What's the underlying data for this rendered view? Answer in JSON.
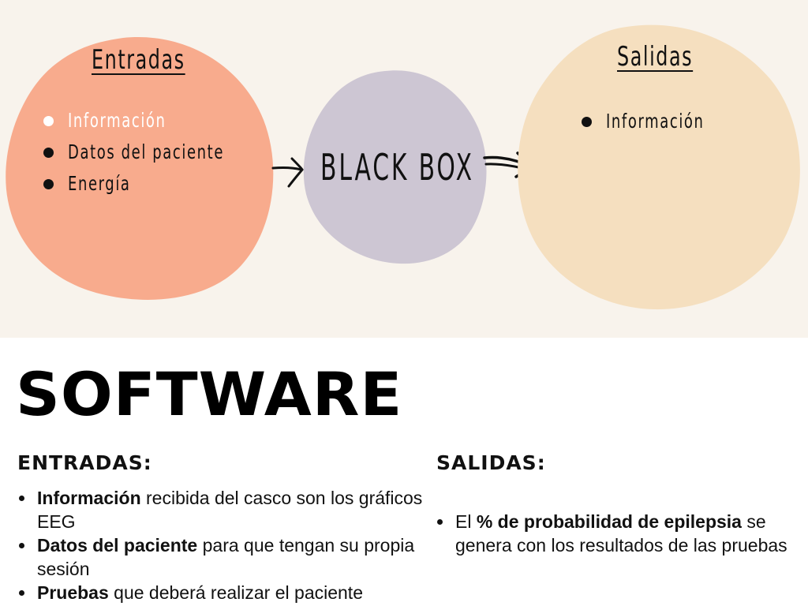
{
  "diagram": {
    "inputs": {
      "title": "Entradas",
      "color": "#f8ab8d",
      "items": [
        {
          "label": "Información",
          "highlighted": true
        },
        {
          "label": "Datos del paciente",
          "highlighted": false
        },
        {
          "label": "Energía",
          "highlighted": false
        }
      ]
    },
    "box": {
      "label": "BLACK BOX",
      "color": "#cdc6d3"
    },
    "outputs": {
      "title": "Salidas",
      "color": "#f5dfbf",
      "items": [
        {
          "label": "Información"
        }
      ]
    },
    "background_color": "#f8f3ec"
  },
  "software": {
    "title": "SOFTWARE",
    "inputs": {
      "heading": "ENTRADAS:",
      "items": [
        {
          "bold": "Información",
          "rest": " recibida del casco son los gráficos EEG"
        },
        {
          "bold": "Datos del paciente",
          "rest": " para que tengan su propia sesión"
        },
        {
          "bold": "Pruebas",
          "rest": " que deberá realizar el paciente"
        }
      ]
    },
    "outputs": {
      "heading": "SALIDAS:",
      "items": [
        {
          "prefix": "El ",
          "bold": "% de probabilidad de epilepsia",
          "rest": " se genera con los resultados de las pruebas"
        }
      ]
    }
  }
}
